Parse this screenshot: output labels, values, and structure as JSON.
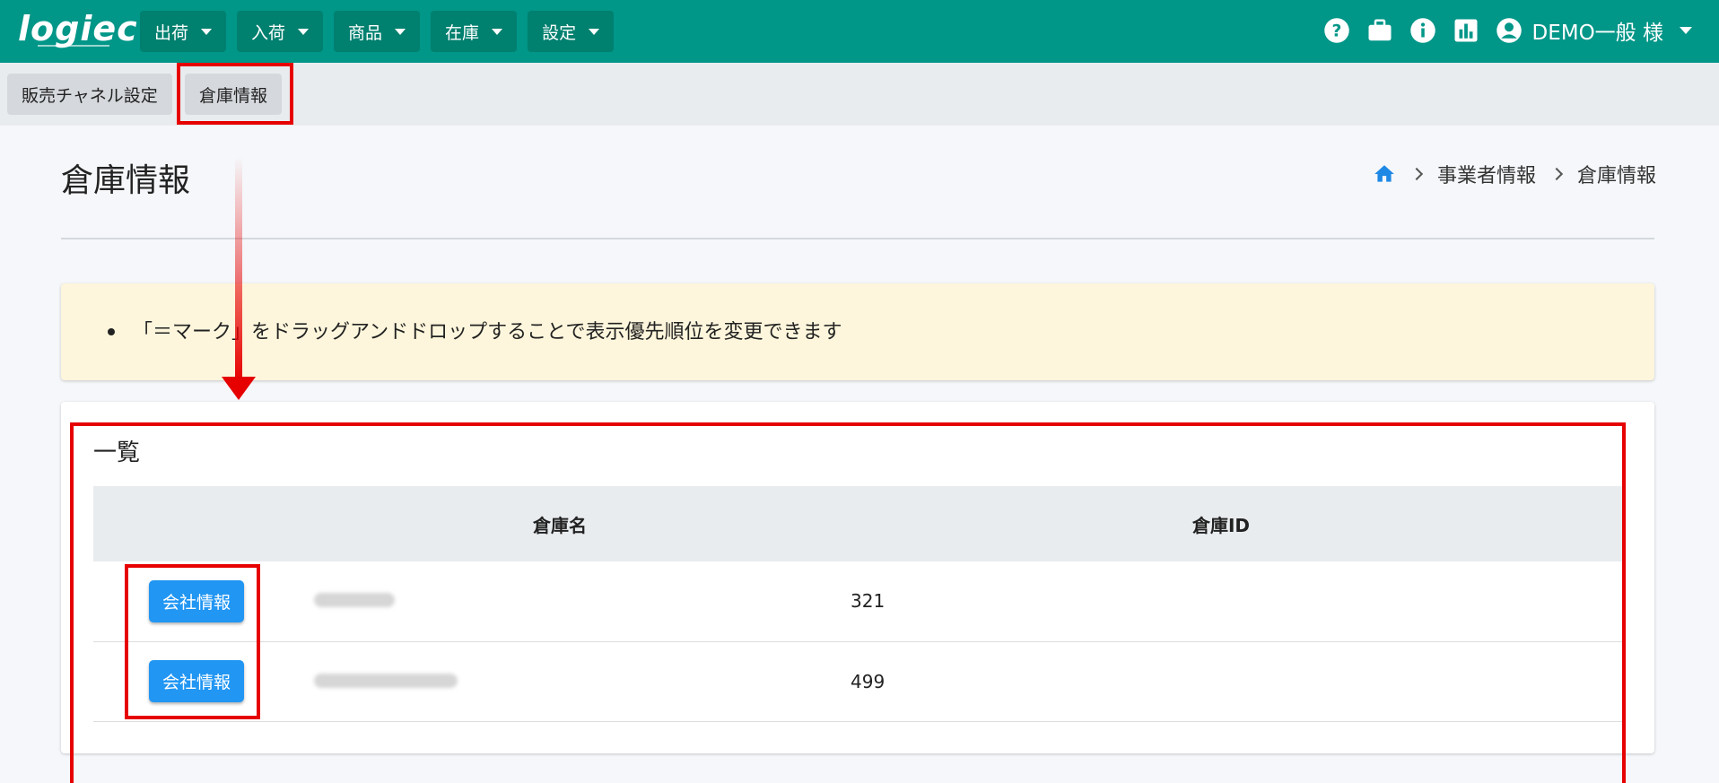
{
  "app": {
    "logo_text": "logiec"
  },
  "topnav": {
    "menus": [
      "出荷",
      "入荷",
      "商品",
      "在庫",
      "設定"
    ],
    "icons": [
      "help-icon",
      "briefcase-icon",
      "info-icon",
      "chart-icon"
    ],
    "user_label": "DEMO一般 様"
  },
  "subnav": {
    "tabs": [
      "販売チャネル設定",
      "倉庫情報"
    ]
  },
  "page": {
    "title": "倉庫情報",
    "breadcrumb": [
      "事業者情報",
      "倉庫情報"
    ]
  },
  "notice": {
    "text": "「＝マーク」をドラッグアンドドロップすることで表示優先順位を変更できます"
  },
  "list": {
    "title": "一覧",
    "columns": [
      "",
      "倉庫名",
      "倉庫ID"
    ],
    "rows": [
      {
        "button_label": "会社情報",
        "warehouse_id": "321"
      },
      {
        "button_label": "会社情報",
        "warehouse_id": "499"
      }
    ]
  },
  "colors": {
    "primary": "#009688",
    "button": "#2196f3",
    "annotation": "#e60000",
    "notice_bg": "#fdf6dc"
  }
}
